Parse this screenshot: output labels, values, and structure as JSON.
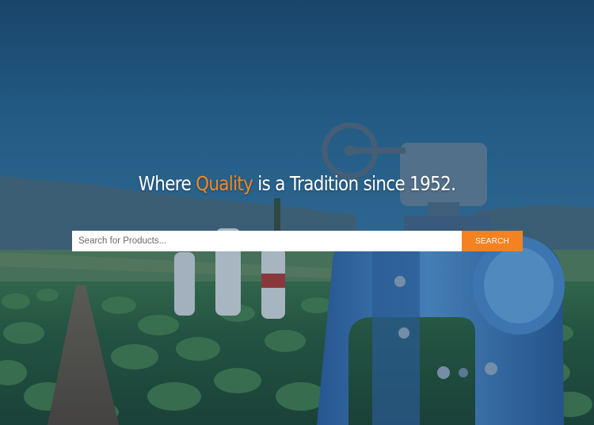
{
  "hero": {
    "headline_before": "Where ",
    "headline_accent": "Quality",
    "headline_after": " is a Tradition since 1952.",
    "background_image": "farm-field-irrigation-valve-photo"
  },
  "search": {
    "placeholder": "Search for Products...",
    "value": "",
    "button_label": "SEARCH"
  },
  "colors": {
    "accent": "#f58220",
    "overlay": "#163a5c",
    "text": "#ffffff"
  }
}
